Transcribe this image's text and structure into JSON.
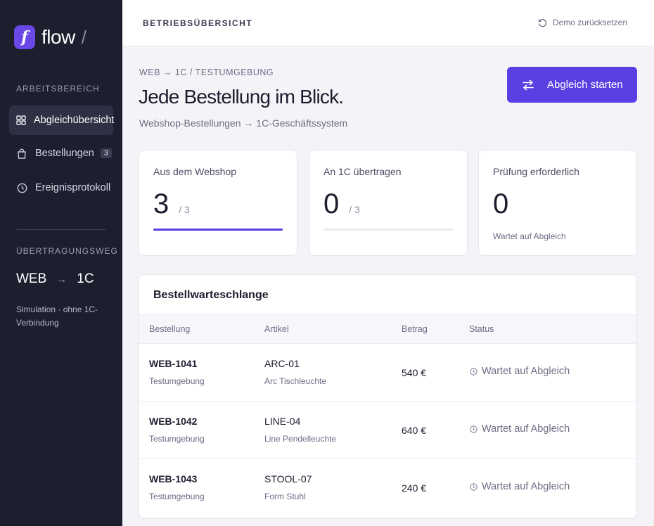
{
  "brand": {
    "mark": "f",
    "name": "flow",
    "separator": "/"
  },
  "sidebar": {
    "section_workspace": "ARBEITSBEREICH",
    "items": [
      {
        "label": "Abgleichübersicht",
        "icon": "grid-icon",
        "active": true
      },
      {
        "label": "Bestellungen",
        "icon": "bag-icon",
        "badge": "3"
      },
      {
        "label": "Ereignisprotokoll",
        "icon": "clock-icon"
      }
    ],
    "section_route": "ÜBERTRAGUNGSWEG",
    "route_from": "WEB",
    "route_arrow": "→",
    "route_to": "1C",
    "route_note": "Simulation · ohne 1C-Verbindung"
  },
  "topbar": {
    "title": "BETRIEBSÜBERSICHT",
    "reset_label": "Demo zurücksetzen"
  },
  "main": {
    "breadcrumb": "WEB → 1C / TESTUMGEBUNG",
    "title": "Jede Bestellung im Blick.",
    "subtitle": "Webshop-Bestellungen → 1C-Geschäftssystem",
    "start_button": "Abgleich starten"
  },
  "stats": [
    {
      "label": "Aus dem Webshop",
      "value": "3",
      "total": "/ 3",
      "progress": 1.0
    },
    {
      "label": "An 1C übertragen",
      "value": "0",
      "total": "/ 3",
      "progress": 0.0
    },
    {
      "label": "Prüfung erforderlich",
      "value": "0",
      "note": "Wartet auf Abgleich"
    }
  ],
  "queue": {
    "title": "Bestellwarteschlange",
    "columns": [
      "Bestellung",
      "Artikel",
      "Betrag",
      "Status"
    ],
    "rows": [
      {
        "id": "WEB-1041",
        "env": "Testumgebung",
        "code": "ARC-01",
        "name": "Arc Tischleuchte",
        "amount": "540 €",
        "status": "Wartet auf Abgleich"
      },
      {
        "id": "WEB-1042",
        "env": "Testumgebung",
        "code": "LINE-04",
        "name": "Line Pendelleuchte",
        "amount": "640 €",
        "status": "Wartet auf Abgleich"
      },
      {
        "id": "WEB-1043",
        "env": "Testumgebung",
        "code": "STOOL-07",
        "name": "Form Stuhl",
        "amount": "240 €",
        "status": "Wartet auf Abgleich"
      }
    ]
  },
  "colors": {
    "accent": "#5b3fe3",
    "sidebar": "#1d1e2e",
    "background": "#f4f4f8"
  }
}
